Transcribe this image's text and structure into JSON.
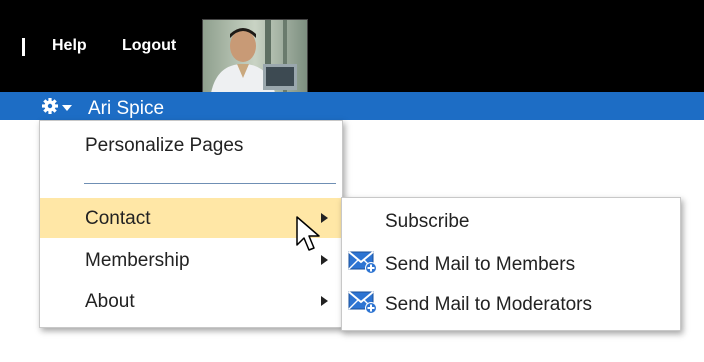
{
  "header": {
    "help_label": "Help",
    "logout_label": "Logout"
  },
  "user_bar": {
    "user_name": "Ari Spice",
    "bar_color": "#1d6dc5"
  },
  "main_menu": {
    "items": [
      {
        "label": "Personalize Pages",
        "has_submenu": false
      },
      {
        "label": "Contact",
        "has_submenu": true,
        "highlighted": true
      },
      {
        "label": "Membership",
        "has_submenu": true
      },
      {
        "label": "About",
        "has_submenu": true
      }
    ],
    "highlight_color": "#ffe7a6"
  },
  "contact_submenu": {
    "items": [
      {
        "label": "Subscribe",
        "icon": ""
      },
      {
        "label": "Send Mail to Members",
        "icon": "mail-add-icon"
      },
      {
        "label": "Send Mail to Moderators",
        "icon": "mail-add-icon"
      }
    ]
  }
}
